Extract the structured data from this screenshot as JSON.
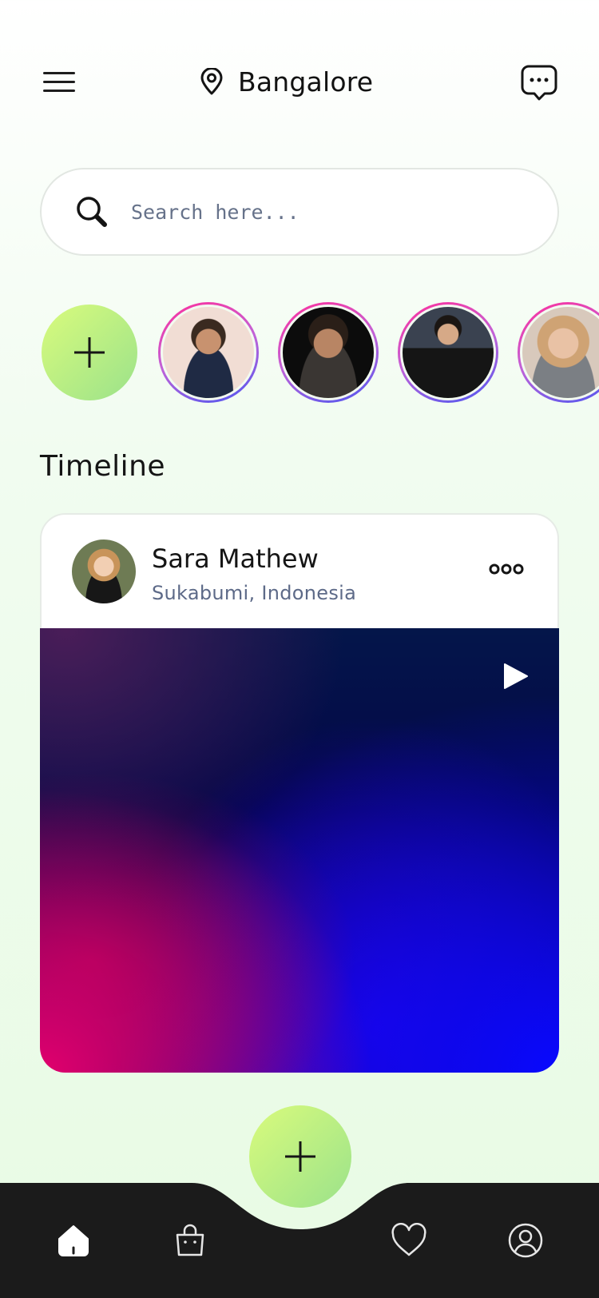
{
  "header": {
    "menu_icon": "hamburger-icon",
    "location_icon": "map-pin-icon",
    "location": "Bangalore",
    "chat_icon": "chat-bubble-icon"
  },
  "search": {
    "icon": "search-icon",
    "placeholder": "Search here...",
    "value": ""
  },
  "stories": {
    "add_icon": "plus-icon",
    "items": [
      {
        "avatar": "story-avatar-1"
      },
      {
        "avatar": "story-avatar-2"
      },
      {
        "avatar": "story-avatar-3"
      },
      {
        "avatar": "story-avatar-4"
      }
    ],
    "ring_colors": [
      "#ff2e9a",
      "#4b56f0"
    ]
  },
  "timeline": {
    "title": "Timeline",
    "posts": [
      {
        "author": "Sara Mathew",
        "location": "Sukabumi, Indonesia",
        "more_icon": "more-dots-icon",
        "media_type": "video",
        "play_icon": "play-icon"
      }
    ]
  },
  "bottom_nav": {
    "items": [
      "home-icon",
      "shopping-bag-icon",
      "heart-icon",
      "profile-icon"
    ],
    "active": "home-icon",
    "fab_icon": "plus-icon"
  },
  "colors": {
    "accent_gradient_start": "#d9fb7c",
    "accent_gradient_end": "#9be28b",
    "nav_background": "#1b1b1b",
    "secondary_text": "#5d6a88"
  }
}
